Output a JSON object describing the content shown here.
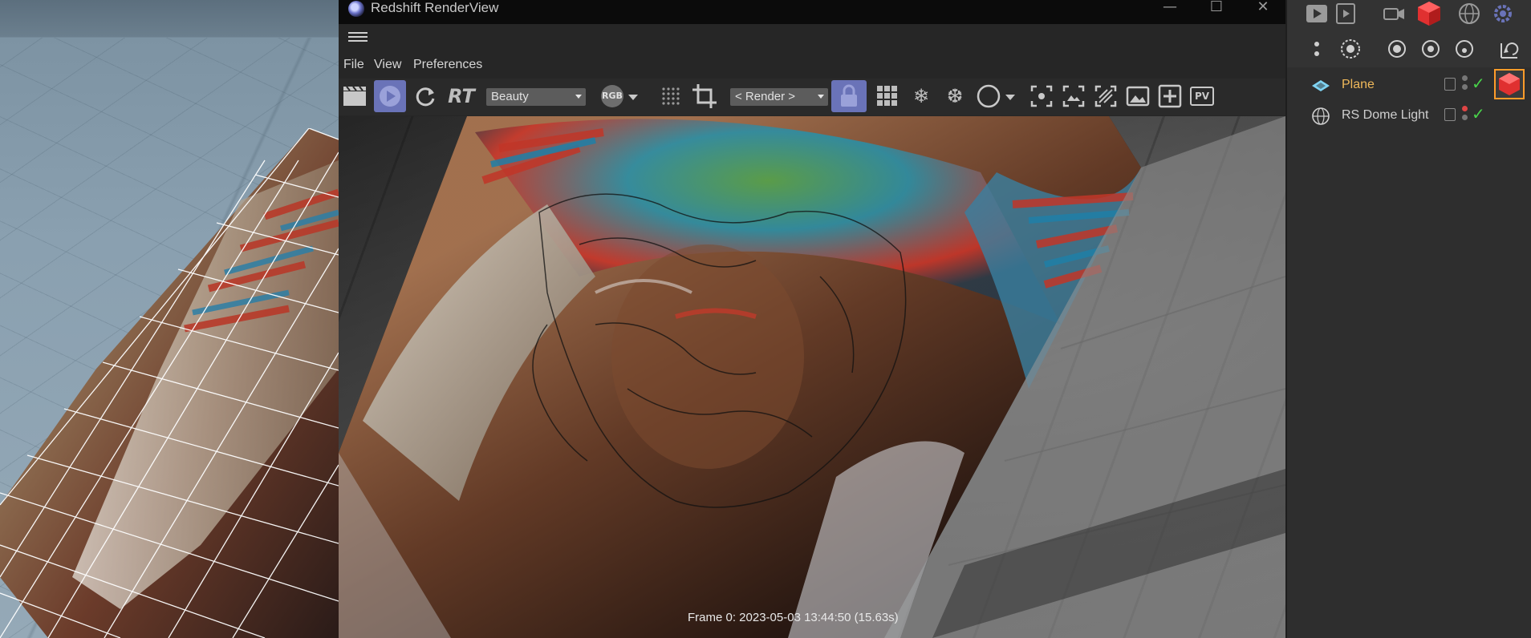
{
  "window": {
    "title": "Redshift RenderView"
  },
  "menu": {
    "file": "File",
    "view": "View",
    "preferences": "Preferences"
  },
  "toolbar": {
    "rt_label": "RT",
    "aov_value": "Beauty",
    "rgb_label": "RGB",
    "camera_value": "< Render >",
    "pv_label": "PV"
  },
  "status": {
    "frame": "Frame  0:  2023-05-03  13:44:50  (15.63s)"
  },
  "objects": [
    {
      "name": "Plane",
      "color": "#f0b95a"
    },
    {
      "name": "RS Dome Light",
      "color": "#cfcfcf"
    }
  ],
  "colors": {
    "active_toggle": "#6a73b8",
    "selection": "#ff9c2a",
    "check": "#49d34a"
  }
}
